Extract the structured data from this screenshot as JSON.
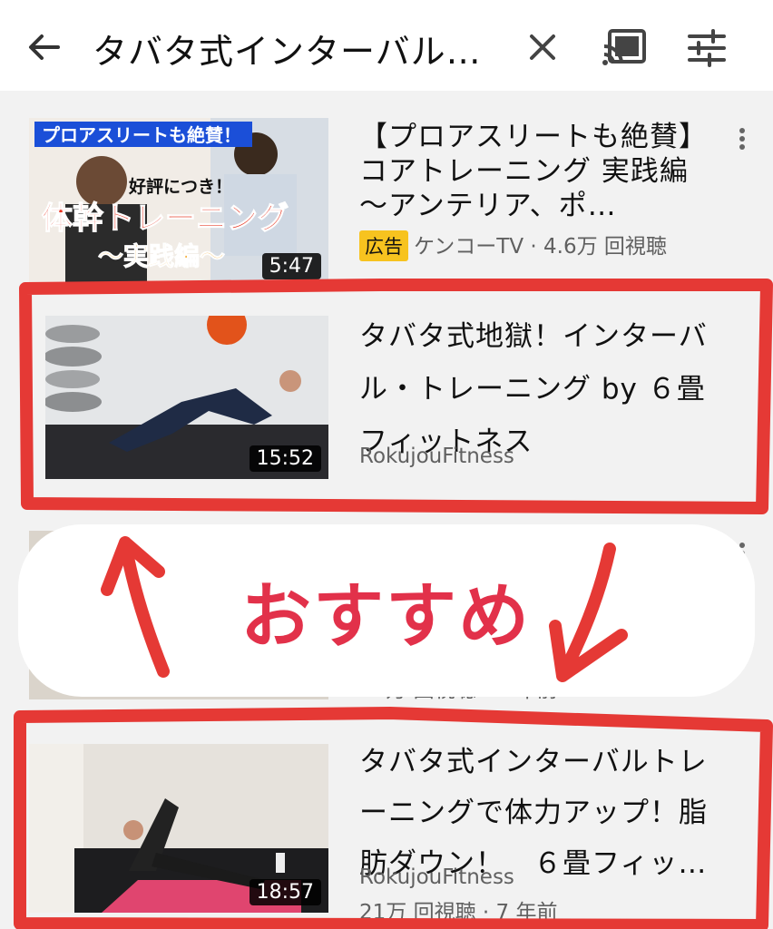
{
  "search": {
    "query": "タバタ式インターバル…"
  },
  "icons": {
    "back": "arrow-left-icon",
    "clear": "close-icon",
    "cast": "cast-icon",
    "filter": "tune-icon",
    "more": "more-vert-icon"
  },
  "results": [
    {
      "title": "【プロアスリートも絶賛】コアトレーニング 実践編 〜アンテリア、ポ…",
      "ad_label": "広告",
      "channel": "ケンコーTV",
      "views": "4.6万 回視聴",
      "duration": "5:47",
      "thumb_texts": [
        "プロアスリートも絶賛！",
        "好評につき！",
        "体幹トレーニング",
        "〜実践編〜"
      ]
    },
    {
      "title": "タバタ式地獄！インターバル・トレーニング by ６畳フィットネス",
      "channel": "RokujouFitness",
      "duration": "15:52"
    },
    {
      "views_age": "72万 回視聴 · 4 年前"
    },
    {
      "title": "タバタ式インターバルトレーニングで体力アップ！脂肪ダウン！　６畳フィッ…",
      "channel": "RokujouFitness",
      "views_age": "21万 回視聴 · 7 年前",
      "duration": "18:57"
    }
  ],
  "annotation": {
    "label": "おすすめ",
    "color": "#e2314a"
  },
  "colors": {
    "accent_red": "#e53935",
    "ad_yellow": "#f7c31f"
  }
}
